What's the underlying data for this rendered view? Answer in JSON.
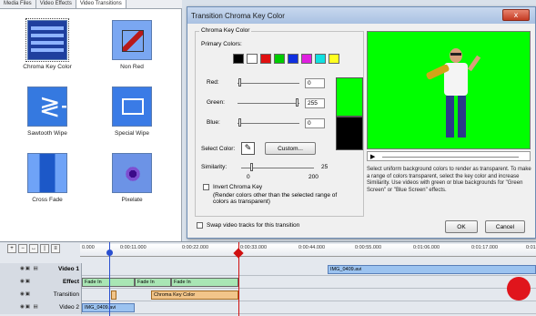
{
  "panel": {
    "tabs": [
      {
        "label": "Media Files"
      },
      {
        "label": "Video Effects"
      },
      {
        "label": "Video Transitions"
      }
    ],
    "effects": [
      {
        "label": "Chroma Key Color"
      },
      {
        "label": "Non Red"
      },
      {
        "label": "Sawtooth Wipe"
      },
      {
        "label": "Special Wipe"
      },
      {
        "label": "Cross Fade"
      },
      {
        "label": "Pixelate"
      }
    ]
  },
  "dialog": {
    "title": "Transition Chroma Key Color",
    "close_glyph": "x",
    "group_title": "Chroma Key Color",
    "primary_colors_label": "Primary Colors:",
    "primary_colors": [
      "#000000",
      "#ffffff",
      "#e01010",
      "#00cc00",
      "#1030e0",
      "#e020e0",
      "#10e0e0",
      "#ffff20"
    ],
    "red_label": "Red:",
    "red_value": "0",
    "green_label": "Green:",
    "green_value": "255",
    "blue_label": "Blue:",
    "blue_value": "0",
    "select_color_label": "Select Color:",
    "custom_button": "Custom...",
    "similarity_label": "Similarity:",
    "similarity_value": "25",
    "similarity_min": "0",
    "similarity_max": "200",
    "invert_label": "Invert Chroma Key",
    "invert_help": "(Render colors other than the selected range of colors as transparent)",
    "swap_label": "Swap video tracks for this transition",
    "play_glyph": "▶",
    "description": "Select uniform background colors to render as transparent. To make a range of colors transparent, select the key color and increase Similarity. Use videos with green or blue backgrounds for \"Green Screen\" or \"Blue Screen\" effects.",
    "ok_button": "OK",
    "cancel_button": "Cancel",
    "key_color": "#00ff00"
  },
  "timeline": {
    "ruler_ticks": [
      "0.000",
      "0:00:11.000",
      "0:00:22.000",
      "0:00:33.000",
      "0:00:44.000",
      "0:00:55.000",
      "0:01:06.000",
      "0:01:17.000",
      "0:01"
    ],
    "rows": [
      {
        "label": "Video 1",
        "clips": [
          {
            "text": "IMG_0409.avi"
          }
        ]
      },
      {
        "label": "Effect",
        "clips": [
          {
            "text": "Fade In"
          },
          {
            "text": "Fade In"
          },
          {
            "text": "Fade In"
          }
        ]
      },
      {
        "label": "Transition",
        "clips": [
          {
            "text": ""
          },
          {
            "text": "Chroma Key Color"
          }
        ]
      },
      {
        "label": "Video 2",
        "clips": [
          {
            "text": "IMG_0409.avi"
          }
        ]
      }
    ]
  }
}
